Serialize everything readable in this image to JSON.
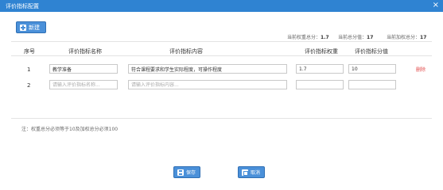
{
  "window": {
    "title": "评价指标配置",
    "close_glyph": "×"
  },
  "toolbar": {
    "new_label": "新建"
  },
  "summary": {
    "weight_label": "当前权重总分：",
    "weight_value": "1.7",
    "score_label": "当前总分值：",
    "score_value": "17",
    "weighted_label": "当前加权总分：",
    "weighted_value": "17"
  },
  "table": {
    "headers": {
      "index": "序号",
      "name": "评价指标名称",
      "content": "评价指标内容",
      "weight": "评价指标权重",
      "score": "评价指标分值"
    },
    "rows": [
      {
        "index": "1",
        "name": "教学准备",
        "content": "符合课程要求和学生实际程度，可操作程度",
        "weight": "1.7",
        "score": "10",
        "action": "删除"
      },
      {
        "index": "2",
        "name": "",
        "content": "",
        "weight": "",
        "score": ""
      }
    ],
    "placeholders": {
      "name": "请输入评价指标名称...",
      "content": "请输入评价指标内容..."
    }
  },
  "note": "注：权重总分必须等于10及加权总分必须100",
  "footer": {
    "save_label": "保存",
    "cancel_label": "取消"
  },
  "icons": {
    "new": "add-icon",
    "save": "save-icon",
    "cancel": "cancel-icon",
    "close": "close-icon"
  },
  "colors": {
    "titlebar": "#2f83d2",
    "button": "#4a90d9",
    "delete": "#e24a4a"
  }
}
